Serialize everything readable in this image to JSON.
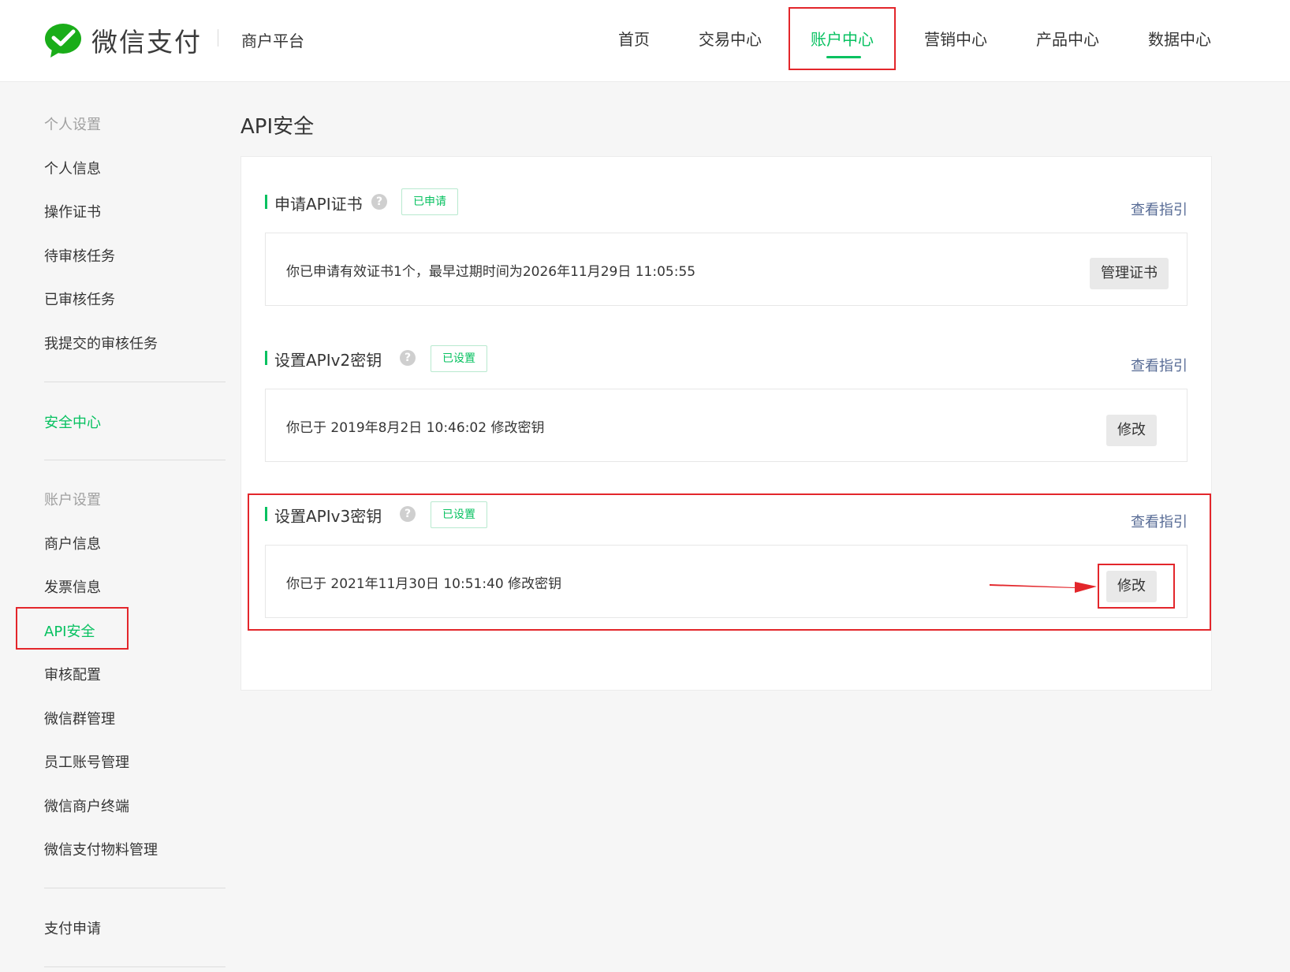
{
  "header": {
    "brand": "微信支付",
    "platform": "商户平台",
    "nav": [
      {
        "label": "首页"
      },
      {
        "label": "交易中心"
      },
      {
        "label": "账户中心"
      },
      {
        "label": "营销中心"
      },
      {
        "label": "产品中心"
      },
      {
        "label": "数据中心"
      }
    ],
    "active_nav": "账户中心"
  },
  "sidebar": {
    "personal_heading": "个人设置",
    "personal_items": [
      "个人信息",
      "操作证书",
      "待审核任务",
      "已审核任务",
      "我提交的审核任务"
    ],
    "security_center": "安全中心",
    "account_heading": "账户设置",
    "account_items": [
      "商户信息",
      "发票信息",
      "API安全",
      "审核配置",
      "微信群管理",
      "员工账号管理",
      "微信商户终端",
      "微信支付物料管理"
    ],
    "active_item": "API安全",
    "payment_apply": "支付申请"
  },
  "main": {
    "title": "API安全",
    "sections": [
      {
        "title": "申请API证书",
        "badge": "已申请",
        "guide": "查看指引",
        "info": "你已申请有效证书1个，最早过期时间为2026年11月29日 11:05:55",
        "button": "管理证书"
      },
      {
        "title": "设置APIv2密钥",
        "badge": "已设置",
        "guide": "查看指引",
        "info": "你已于 2019年8月2日 10:46:02 修改密钥",
        "button": "修改"
      },
      {
        "title": "设置APIv3密钥",
        "badge": "已设置",
        "guide": "查看指引",
        "info": "你已于 2021年11月30日 10:51:40 修改密钥",
        "button": "修改"
      }
    ]
  },
  "icons": {
    "logo": "wechat-pay-logo-icon",
    "help": "question-circle-icon",
    "annotation_arrow": "red-arrow-icon"
  },
  "colors": {
    "brand_green": "#07c160",
    "link_blue": "#576b95",
    "annotation_red": "#e3262b",
    "page_bg": "#f6f6f6"
  }
}
